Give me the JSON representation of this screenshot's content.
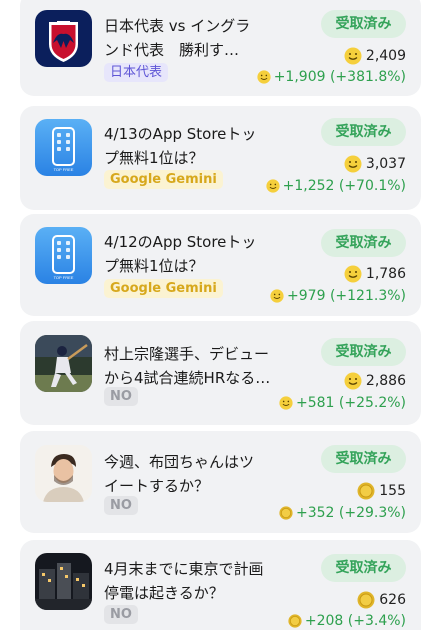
{
  "colors": {
    "card_bg": "#f1f2f4",
    "status_bg": "#dcefe1",
    "status_text": "#34a35a",
    "payout_text": "#2ea04e",
    "tag_blue": "#5f56d6",
    "tag_yellow": "#d7a81c",
    "tag_gray": "#9a9ca3"
  },
  "cards": [
    {
      "thumb_icon": "japan-national-team-icon",
      "title": "日本代表 vs イングラ\nンド代表　勝利す…",
      "tag": "日本代表",
      "status": "受取済み",
      "bet_icon": "smile-coin-icon",
      "bet": "2,409",
      "payout": "+1,909 (+381.8%)"
    },
    {
      "thumb_icon": "app-store-phone-icon",
      "title": "4/13のApp Storeトッ\nプ無料1位は？",
      "tag": "Google Gemini",
      "status": "受取済み",
      "bet_icon": "smile-coin-icon",
      "bet": "3,037",
      "payout": "+1,252 (+70.1%)"
    },
    {
      "thumb_icon": "app-store-phone-icon",
      "title": "4/12のApp Storeトッ\nプ無料1位は？",
      "tag": "Google Gemini",
      "status": "受取済み",
      "bet_icon": "smile-coin-icon",
      "bet": "1,786",
      "payout": "+979 (+121.3%)"
    },
    {
      "thumb_icon": "baseball-player-photo",
      "title": "村上宗隆選手、デビュー\nから4試合連続HRなる…",
      "tag": "NO",
      "status": "受取済み",
      "bet_icon": "smile-coin-icon",
      "bet": "2,886",
      "payout": "+581 (+25.2%)"
    },
    {
      "thumb_icon": "man-portrait-photo",
      "title": "今週、布団ちゃんはツ\nイートするか？",
      "tag": "NO",
      "status": "受取済み",
      "bet_icon": "gold-coin-icon",
      "bet": "155",
      "payout": "+352 (+29.3%)"
    },
    {
      "thumb_icon": "night-city-photo",
      "title": "4月末までに東京で計画\n停電は起きるか？",
      "tag": "NO",
      "status": "受取済み",
      "bet_icon": "gold-coin-icon",
      "bet": "626",
      "payout": "+208 (+3.4%)"
    }
  ],
  "app_icon_caption": "TOP FREE"
}
